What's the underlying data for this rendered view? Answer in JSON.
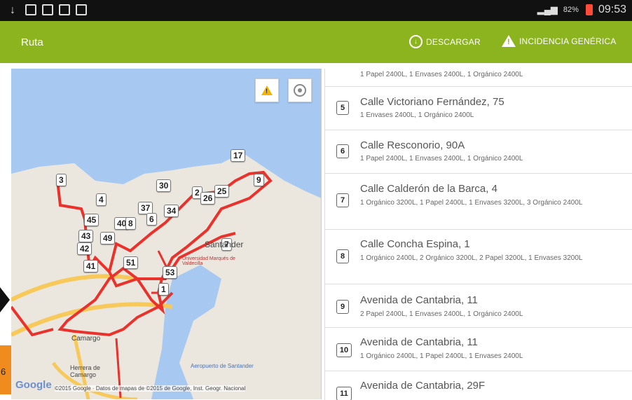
{
  "status_bar": {
    "battery": "82%",
    "time": "09:53",
    "icons": [
      "usb-icon",
      "notification-icon",
      "gallery-icon",
      "sync-icon",
      "camera-icon"
    ]
  },
  "app_bar": {
    "title": "Ruta",
    "download_label": "DESCARGAR",
    "incident_label": "INCIDENCIA GENÉRICA",
    "color": "#8cb41f"
  },
  "map": {
    "pins": [
      "3",
      "4",
      "45",
      "43",
      "42",
      "41",
      "40",
      "8",
      "49",
      "30",
      "37",
      "6",
      "34",
      "2",
      "26",
      "25",
      "17",
      "9",
      "7",
      "51",
      "53",
      "1"
    ],
    "labels": {
      "santander": "Santander",
      "university": "Universidad Marqués de Valdecilla",
      "camargo": "Camargo",
      "herrera": "Herrera de Camargo",
      "airport": "Aeropuerto de Santander"
    },
    "google_label": "Google",
    "attribution": "©2015 Google · Datos de mapas de ©2015 de Google, Inst. Geogr. Nacional",
    "route_color": "#e8322b"
  },
  "edge_fragment": "6",
  "list": {
    "items": [
      {
        "number": "",
        "street": "",
        "detail": "1 Papel 2400L, 1 Envases 2400L, 1 Orgánico 2400L"
      },
      {
        "number": "5",
        "street": "Calle Victoriano Fernández, 75",
        "detail": "1 Envases 2400L, 1 Orgánico 2400L"
      },
      {
        "number": "6",
        "street": "Calle Resconorio, 90A",
        "detail": "1 Papel 2400L, 1 Envases 2400L, 1 Orgánico 2400L"
      },
      {
        "number": "7",
        "street": "Calle Calderón de la Barca, 4",
        "detail": "1 Orgánico 3200L, 1 Papel 2400L, 1 Envases 3200L, 3 Orgánico 2400L"
      },
      {
        "number": "8",
        "street": "Calle Concha Espina, 1",
        "detail": "1 Orgánico 2400L, 2 Orgánico 3200L, 2 Papel 3200L, 1 Envases 3200L"
      },
      {
        "number": "9",
        "street": "Avenida de Cantabria, 11",
        "detail": "2 Papel 2400L, 1 Envases 2400L, 1 Orgánico 2400L"
      },
      {
        "number": "10",
        "street": "Avenida de Cantabria, 11",
        "detail": "1 Orgánico 2400L, 1 Papel 2400L, 1 Envases 2400L"
      },
      {
        "number": "11",
        "street": "Avenida de Cantabria, 29F",
        "detail": ""
      }
    ]
  }
}
